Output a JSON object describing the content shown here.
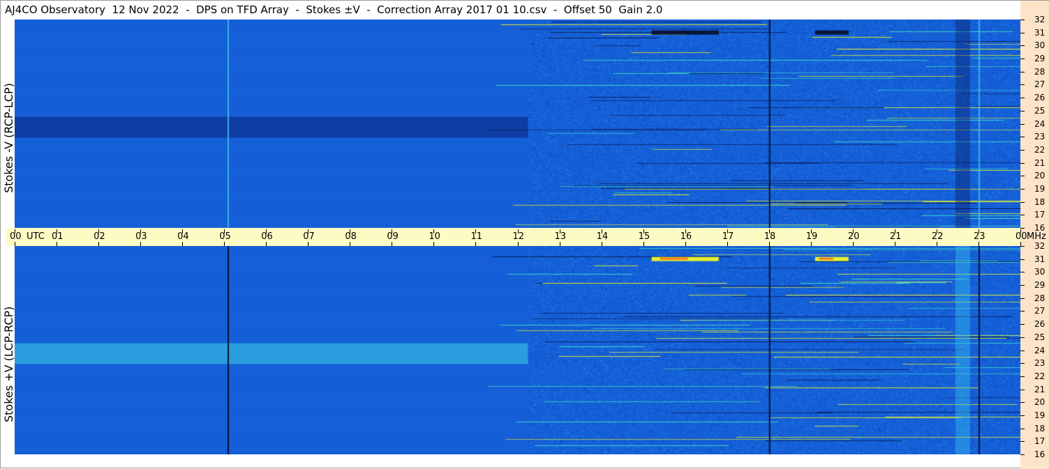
{
  "title": "AJ4CO Observatory  12 Nov 2022  -  DPS on TFD Array  -  Stokes ±V  -  Correction Array 2017 01 10.csv  -  Offset 50  Gain 2.0",
  "chart_data": [
    {
      "type": "heatmap",
      "panel": "top",
      "ylabel": "Stokes -V (RCP-LCP)",
      "x_range": [
        0,
        24
      ],
      "y_range": [
        16,
        32
      ],
      "y_ticks": [
        "32",
        "31",
        "30",
        "29",
        "28",
        "27",
        "26",
        "25",
        "24",
        "23",
        "22",
        "21",
        "20",
        "19",
        "18",
        "17",
        "16"
      ],
      "colormap": [
        "#0f3fa8",
        "#1a64e0",
        "#22a0f0",
        "#3fdcc8",
        "#e6ef2a",
        "#ff7a20"
      ]
    },
    {
      "type": "heatmap",
      "panel": "bottom",
      "ylabel": "Stokes +V (LCP-RCP)",
      "x_range": [
        0,
        24
      ],
      "y_range": [
        16,
        32
      ],
      "y_ticks": [
        "32",
        "31",
        "30",
        "29",
        "28",
        "27",
        "26",
        "25",
        "24",
        "23",
        "22",
        "21",
        "20",
        "19",
        "18",
        "17",
        "16"
      ],
      "colormap": [
        "#0f3fa8",
        "#1a64e0",
        "#22a0f0",
        "#3fdcc8",
        "#e6ef2a",
        "#ff7a20"
      ]
    }
  ],
  "time_axis": {
    "labels": [
      "00",
      "UTC",
      "01",
      "02",
      "03",
      "04",
      "05",
      "06",
      "07",
      "08",
      "09",
      "10",
      "11",
      "12",
      "13",
      "14",
      "15",
      "16",
      "17",
      "18",
      "19",
      "20",
      "21",
      "22",
      "23",
      "00",
      "MHz"
    ]
  }
}
